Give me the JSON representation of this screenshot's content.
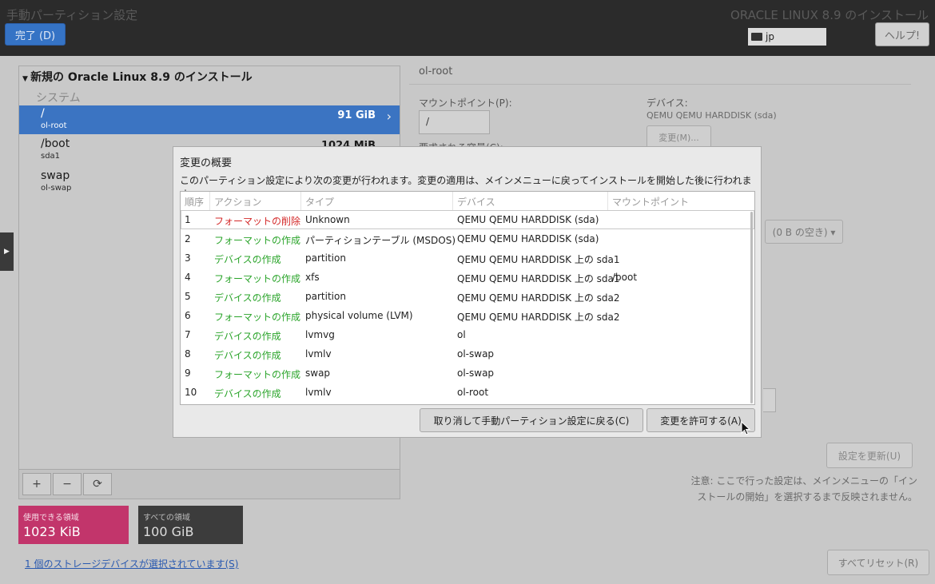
{
  "header": {
    "title": "手動パーティション設定",
    "done_label": "完了 (D)",
    "product": "ORACLE LINUX 8.9 のインストール",
    "keyboard": "jp",
    "help_label": "ヘルプ!"
  },
  "left": {
    "install_title": "新規の Oracle Linux 8.9 のインストール",
    "system_label": "システム",
    "mounts": [
      {
        "name": "/",
        "device": "ol-root",
        "size": "91 GiB"
      },
      {
        "name": "/boot",
        "device": "sda1",
        "size": "1024 MiB"
      },
      {
        "name": "swap",
        "device": "ol-swap",
        "size": ""
      }
    ],
    "add_label": "+",
    "remove_label": "−",
    "refresh_label": "⟳",
    "available_label": "使用できる領域",
    "available_value": "1023 KiB",
    "total_label": "すべての領域",
    "total_value": "100 GiB",
    "storage_link": "1 個のストレージデバイスが選択されています(S)"
  },
  "right": {
    "title": "ol-root",
    "mountpoint_label": "マウントポイント(P):",
    "mountpoint_value": "/",
    "capacity_label": "要求される容量(C):",
    "device_label": "デバイス:",
    "device_value": "QEMU QEMU HARDDISK (sda)",
    "change_label": "変更(M)...",
    "free_label": "(0 B の空き) ▾",
    "update_label": "設定を更新(U)",
    "note": "注意: ここで行った設定は、メインメニューの「インストールの開始」を選択するまで反映されません。",
    "reset_label": "すべてリセット(R)"
  },
  "dialog": {
    "title": "変更の概要",
    "description": "このパーティション設定により次の変更が行われます。変更の適用は、メインメニューに戻ってインストールを開始した後に行われます:",
    "columns": [
      "順序",
      "アクション",
      "タイプ",
      "デバイス",
      "マウントポイント"
    ],
    "rows": [
      {
        "order": "1",
        "action": "フォーマットの削除",
        "kind": "delete",
        "type": "Unknown",
        "device": "QEMU QEMU HARDDISK (sda)",
        "mount": ""
      },
      {
        "order": "2",
        "action": "フォーマットの作成",
        "kind": "create",
        "type": "パーティションテーブル (MSDOS)",
        "device": "QEMU QEMU HARDDISK (sda)",
        "mount": ""
      },
      {
        "order": "3",
        "action": "デバイスの作成",
        "kind": "create",
        "type": "partition",
        "device": "QEMU QEMU HARDDISK 上の sda1",
        "mount": ""
      },
      {
        "order": "4",
        "action": "フォーマットの作成",
        "kind": "create",
        "type": "xfs",
        "device": "QEMU QEMU HARDDISK 上の sda1",
        "mount": "/boot"
      },
      {
        "order": "5",
        "action": "デバイスの作成",
        "kind": "create",
        "type": "partition",
        "device": "QEMU QEMU HARDDISK 上の sda2",
        "mount": ""
      },
      {
        "order": "6",
        "action": "フォーマットの作成",
        "kind": "create",
        "type": "physical volume (LVM)",
        "device": "QEMU QEMU HARDDISK 上の sda2",
        "mount": ""
      },
      {
        "order": "7",
        "action": "デバイスの作成",
        "kind": "create",
        "type": "lvmvg",
        "device": "ol",
        "mount": ""
      },
      {
        "order": "8",
        "action": "デバイスの作成",
        "kind": "create",
        "type": "lvmlv",
        "device": "ol-swap",
        "mount": ""
      },
      {
        "order": "9",
        "action": "フォーマットの作成",
        "kind": "create",
        "type": "swap",
        "device": "ol-swap",
        "mount": ""
      },
      {
        "order": "10",
        "action": "デバイスの作成",
        "kind": "create",
        "type": "lvmlv",
        "device": "ol-root",
        "mount": ""
      }
    ],
    "cancel_label": "取り消して手動パーティション設定に戻る(C)",
    "accept_label": "変更を許可する(A)"
  },
  "colors": {
    "accent": "#3b74c2",
    "delete": "#d42a2a",
    "create": "#2aa42a",
    "available_bg": "#c2356b",
    "total_bg": "#3c3c3c"
  }
}
